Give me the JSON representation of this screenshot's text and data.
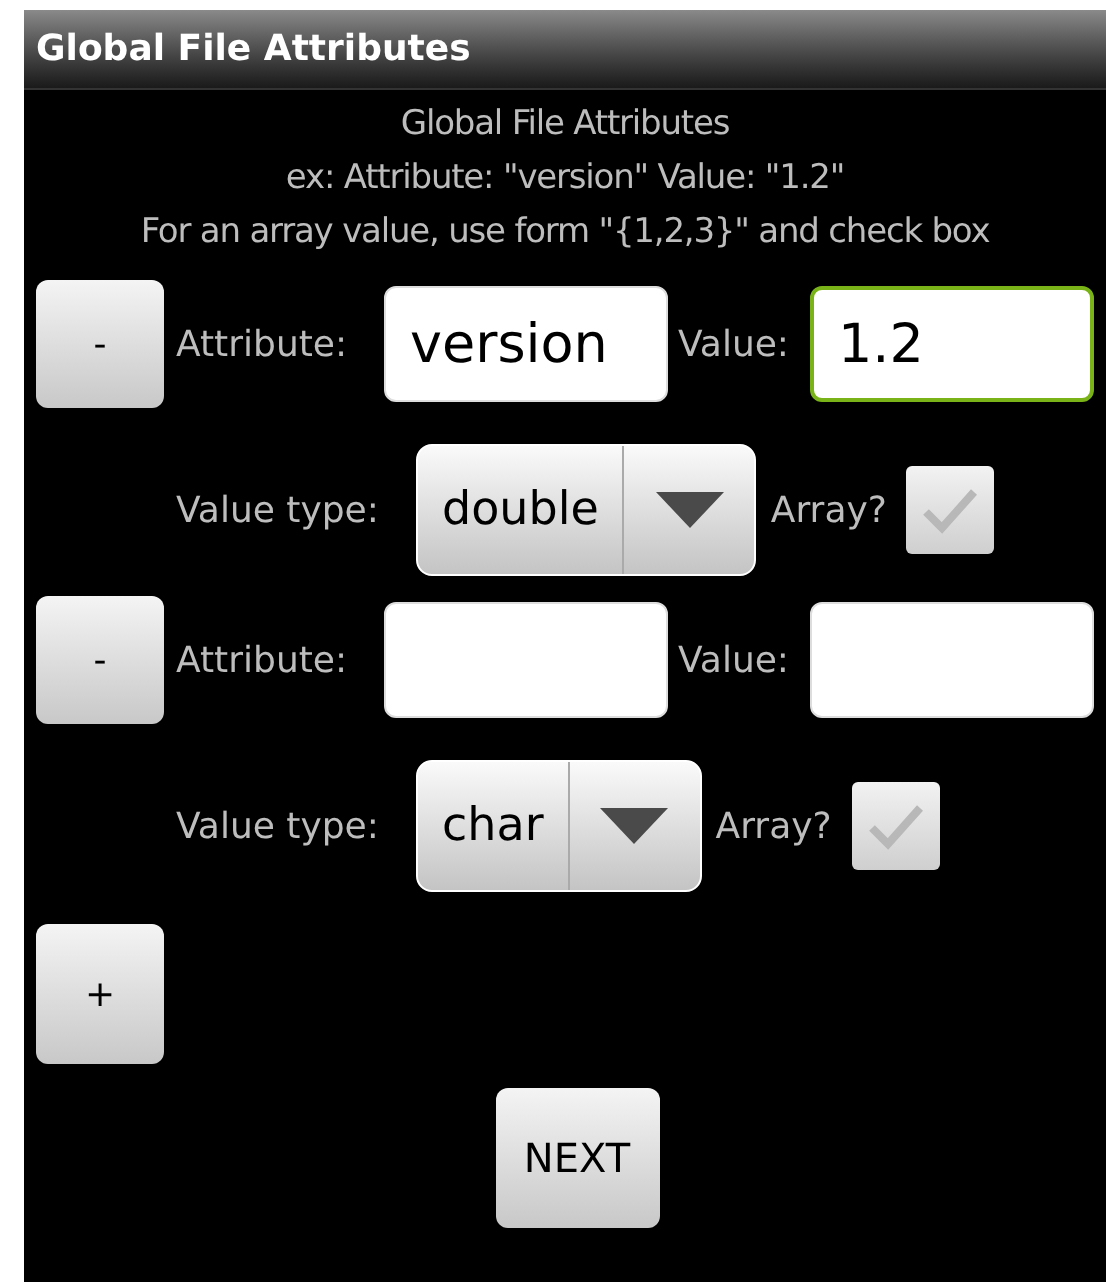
{
  "window": {
    "title": "Global File Attributes"
  },
  "header": [
    "Global File Attributes",
    "ex: Attribute: \"version\" Value: \"1.2\"",
    "For an array value, use form \"{1,2,3}\" and check box"
  ],
  "attributes": [
    {
      "remove_label": "-",
      "attribute_label": "Attribute:",
      "attribute_value": "version",
      "attribute_focused": false,
      "value_label": "Value:",
      "value_value": "1.2",
      "value_focused": true,
      "type_label": "Value type:",
      "type_value": "double",
      "array_label": "Array?",
      "array_checked": false
    },
    {
      "remove_label": "-",
      "attribute_label": "Attribute:",
      "attribute_focused": false,
      "value_label": "Value:",
      "value_focused": false,
      "type_label": "Value type:",
      "type_value": "char",
      "array_label": "Array?",
      "array_checked": false
    }
  ],
  "add_button": "+",
  "next_button": "NEXT"
}
